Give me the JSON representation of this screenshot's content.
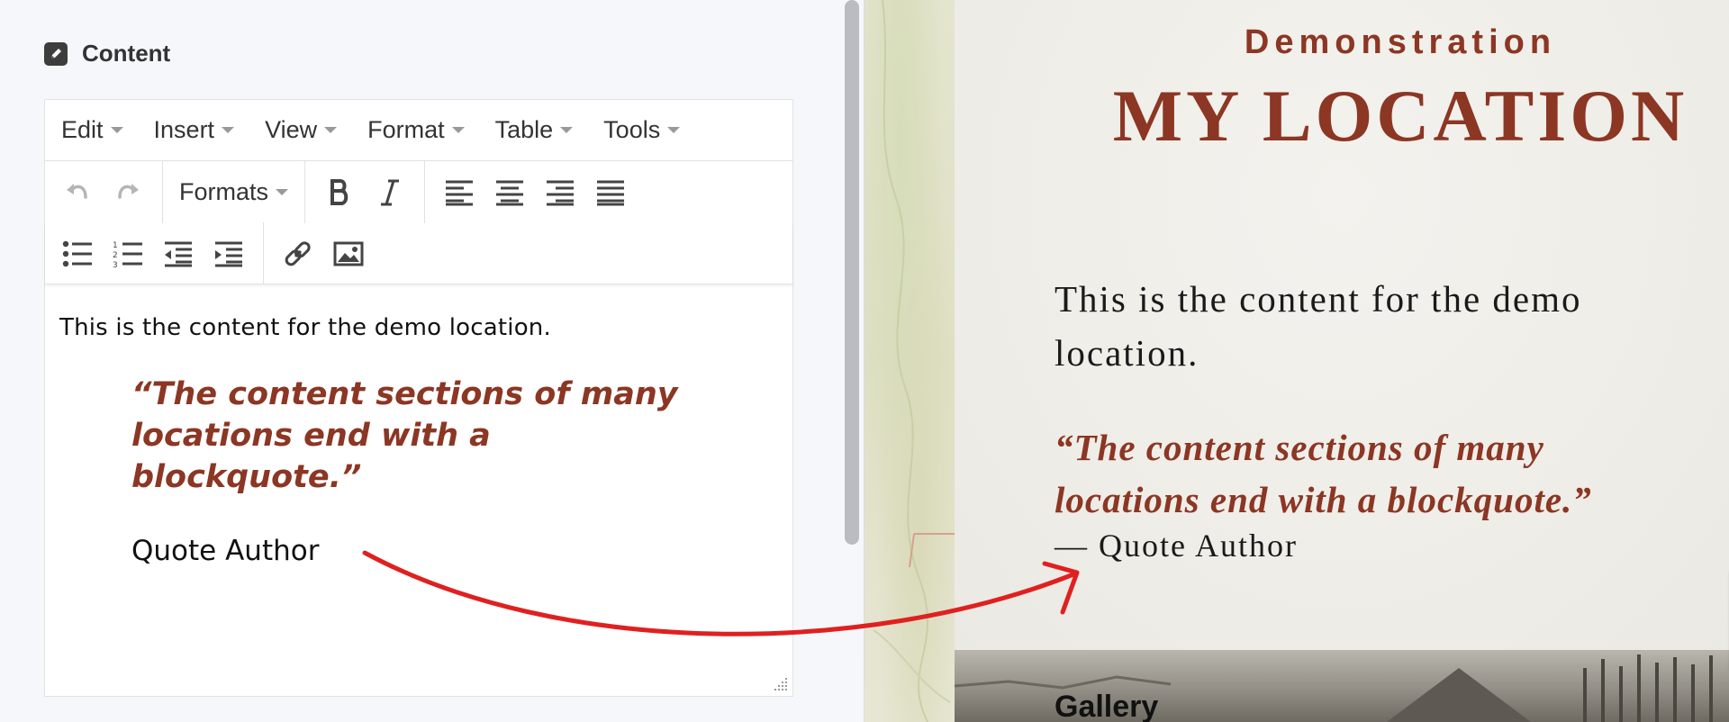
{
  "section": {
    "title": "Content",
    "icon": "pencil-icon"
  },
  "editor": {
    "menus": [
      "Edit",
      "Insert",
      "View",
      "Format",
      "Table",
      "Tools"
    ],
    "formats_label": "Formats",
    "toolbar_icons": [
      "undo-icon",
      "redo-icon",
      "bold-icon",
      "italic-icon",
      "align-left-icon",
      "align-center-icon",
      "align-right-icon",
      "justify-icon",
      "bullet-list-icon",
      "numbered-list-icon",
      "outdent-icon",
      "indent-icon",
      "link-icon",
      "image-icon"
    ],
    "paragraph": "This is the content for the demo location.",
    "quote": "“The content sections of many locations end with a blockquote.”",
    "author": "Quote Author"
  },
  "preview": {
    "subtitle": "Demonstration",
    "title": "MY LOCATION",
    "paragraph": "This is the content for the demo location.",
    "quote": "“The content sections of many locations end with a blockquote.”",
    "author": "— Quote Author",
    "gallery_title": "Gallery"
  },
  "colors": {
    "accent": "#8c3624",
    "annotation_arrow": "#e02020"
  }
}
